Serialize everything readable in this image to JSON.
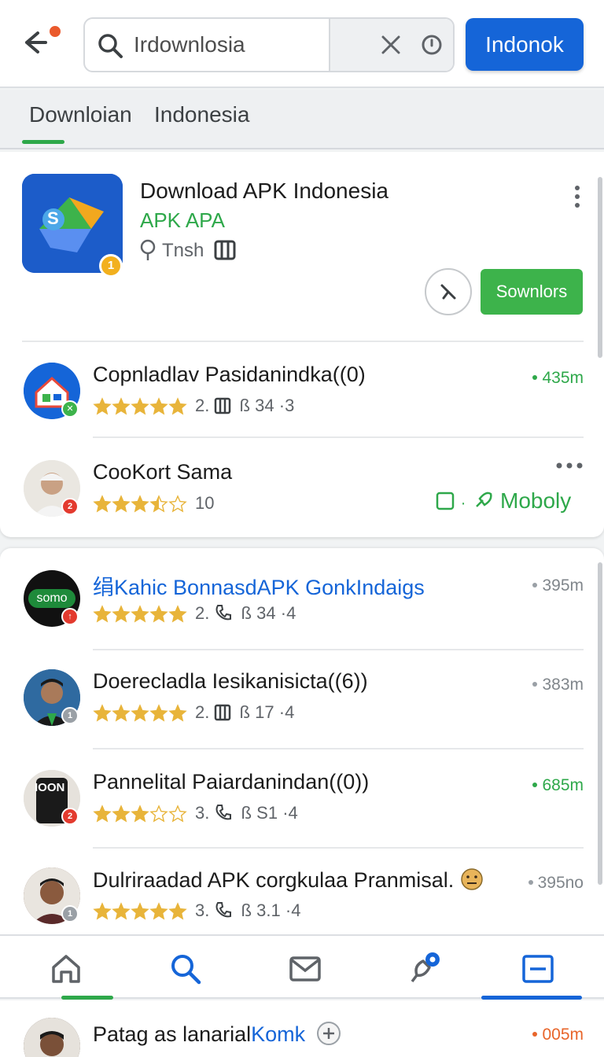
{
  "header": {
    "search_value": "Irdownlosia",
    "primary_button": "Indonok"
  },
  "tabs": [
    {
      "label": "Downloian",
      "active": true
    },
    {
      "label": "Indonesia",
      "active": false
    }
  ],
  "featured": {
    "title": "Download APK Indonesia",
    "subtitle": "APK APA",
    "location": "Tnsh",
    "badge": "1",
    "download_button": "Sownlors",
    "icon_letter": "S"
  },
  "apps": [
    {
      "title": "Copnladlav Pasidanindka‪((0)",
      "rating": 5,
      "meta_rank": "2.",
      "meta_icon": "grid-icon",
      "meta_value": "34",
      "meta_suffix": "·3",
      "size": "435m",
      "size_color": "green",
      "avatar": "house-icon",
      "avatar_bg": "#1565d8"
    },
    {
      "title": "CooKort Sama",
      "rating": 3.5,
      "meta_rank": "10",
      "size": "",
      "action_label": "Moboly",
      "avatar": "person-avatar",
      "avatar_bg": "#e0e0e0"
    },
    {
      "title": "绢Kahic BonnasdAPK GonkIndaigs",
      "link": true,
      "rating": 5,
      "meta_rank": "2.",
      "meta_icon": "phone-icon",
      "meta_value": "34",
      "meta_suffix": "·4",
      "size": "395m",
      "size_color": "gray",
      "avatar_label": "somo",
      "avatar_bg": "#111111"
    },
    {
      "title": "Doerecladla Iesikanisicta((6))",
      "rating": 5,
      "meta_rank": "2.",
      "meta_icon": "grid-icon",
      "meta_value": "17",
      "meta_suffix": "·4",
      "size": "383m",
      "size_color": "gray",
      "avatar": "person-avatar",
      "avatar_bg": "#2a5a8a"
    },
    {
      "title": "Pannelital Paiardanindan((0))",
      "rating": 3,
      "meta_rank": "3.",
      "meta_icon": "phone-icon",
      "meta_value": "S1",
      "meta_suffix": "·4",
      "size": "685m",
      "size_color": "green",
      "avatar_label": "IOON",
      "avatar_bg": "#1a1a1a"
    },
    {
      "title": "Dulriraadad APK corgkulaa Pranmisal.",
      "rating": 5,
      "meta_rank": "3.",
      "meta_icon": "phone-icon",
      "meta_value": "3.1",
      "meta_suffix": "·4",
      "size": "395no",
      "size_color": "gray",
      "avatar": "person-avatar",
      "avatar_bg": "#6b4b3a"
    }
  ],
  "peek": {
    "title_a": "Patag as lanarial",
    "title_b": "Komk",
    "size": "005m"
  },
  "nav": [
    "home-icon",
    "search-icon",
    "mail-icon",
    "notify-icon",
    "list-icon"
  ],
  "colors": {
    "accent": "#1565d8",
    "green": "#2ea84a",
    "orange": "#e8652a",
    "star": "#e8b43a"
  }
}
